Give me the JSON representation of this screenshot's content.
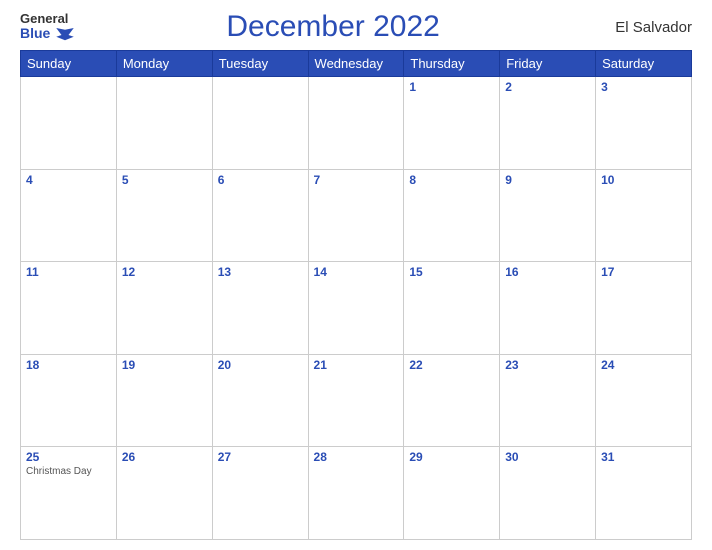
{
  "header": {
    "logo_general": "General",
    "logo_blue": "Blue",
    "title": "December 2022",
    "country": "El Salvador"
  },
  "weekdays": [
    "Sunday",
    "Monday",
    "Tuesday",
    "Wednesday",
    "Thursday",
    "Friday",
    "Saturday"
  ],
  "weeks": [
    [
      {
        "day": "",
        "holiday": ""
      },
      {
        "day": "",
        "holiday": ""
      },
      {
        "day": "",
        "holiday": ""
      },
      {
        "day": "",
        "holiday": ""
      },
      {
        "day": "1",
        "holiday": ""
      },
      {
        "day": "2",
        "holiday": ""
      },
      {
        "day": "3",
        "holiday": ""
      }
    ],
    [
      {
        "day": "4",
        "holiday": ""
      },
      {
        "day": "5",
        "holiday": ""
      },
      {
        "day": "6",
        "holiday": ""
      },
      {
        "day": "7",
        "holiday": ""
      },
      {
        "day": "8",
        "holiday": ""
      },
      {
        "day": "9",
        "holiday": ""
      },
      {
        "day": "10",
        "holiday": ""
      }
    ],
    [
      {
        "day": "11",
        "holiday": ""
      },
      {
        "day": "12",
        "holiday": ""
      },
      {
        "day": "13",
        "holiday": ""
      },
      {
        "day": "14",
        "holiday": ""
      },
      {
        "day": "15",
        "holiday": ""
      },
      {
        "day": "16",
        "holiday": ""
      },
      {
        "day": "17",
        "holiday": ""
      }
    ],
    [
      {
        "day": "18",
        "holiday": ""
      },
      {
        "day": "19",
        "holiday": ""
      },
      {
        "day": "20",
        "holiday": ""
      },
      {
        "day": "21",
        "holiday": ""
      },
      {
        "day": "22",
        "holiday": ""
      },
      {
        "day": "23",
        "holiday": ""
      },
      {
        "day": "24",
        "holiday": ""
      }
    ],
    [
      {
        "day": "25",
        "holiday": "Christmas Day"
      },
      {
        "day": "26",
        "holiday": ""
      },
      {
        "day": "27",
        "holiday": ""
      },
      {
        "day": "28",
        "holiday": ""
      },
      {
        "day": "29",
        "holiday": ""
      },
      {
        "day": "30",
        "holiday": ""
      },
      {
        "day": "31",
        "holiday": ""
      }
    ]
  ]
}
